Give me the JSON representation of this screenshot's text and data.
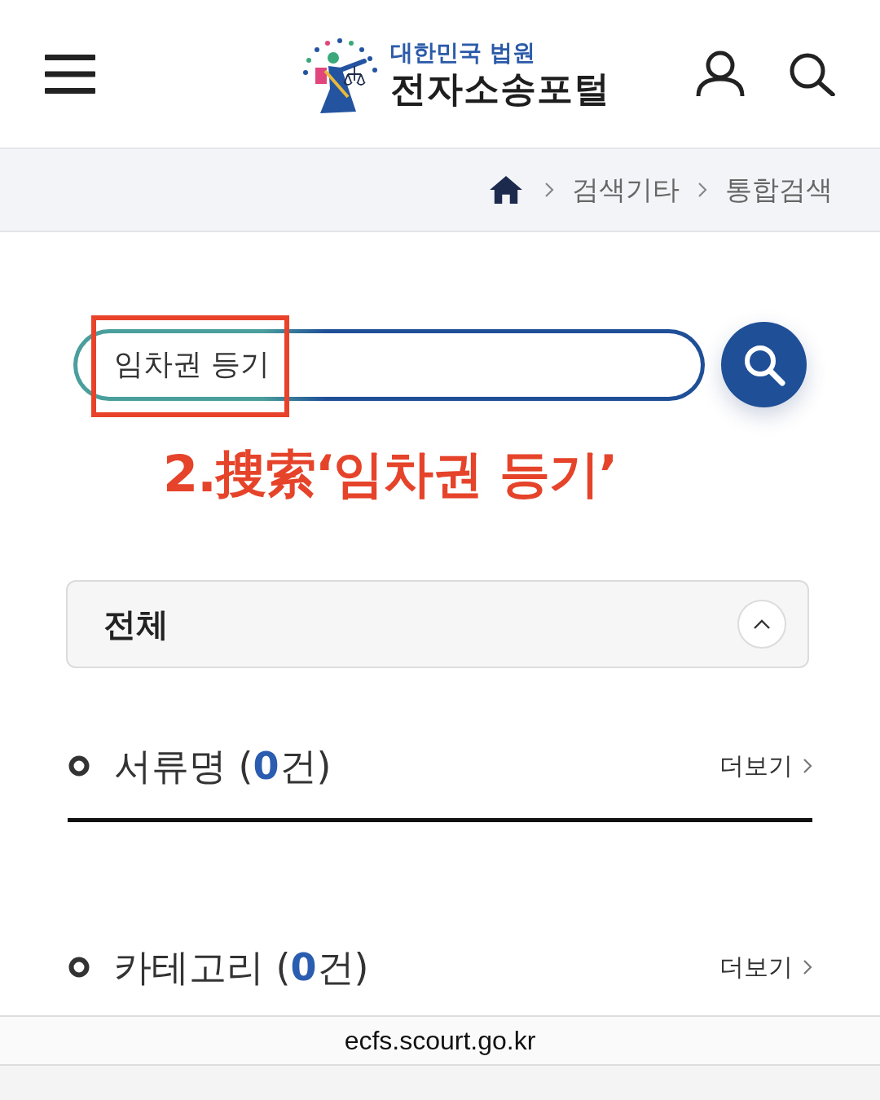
{
  "header": {
    "logo": {
      "org": "대한민국 법원",
      "title": "전자소송포털"
    }
  },
  "breadcrumb": [
    {
      "label": "검색기타"
    },
    {
      "label": "통합검색"
    }
  ],
  "search": {
    "value": "임차권 등기"
  },
  "annotation": {
    "text": "2.搜索‘임차권 등기’"
  },
  "filter": {
    "label": "전체",
    "expanded": true
  },
  "sections": [
    {
      "title": "서류명 (**0**건)",
      "more": "더보기"
    },
    {
      "title": "카테고리 (**0**건)",
      "more": "더보기"
    }
  ],
  "browser_bar": {
    "url": "ecfs.scourt.go.kr"
  }
}
